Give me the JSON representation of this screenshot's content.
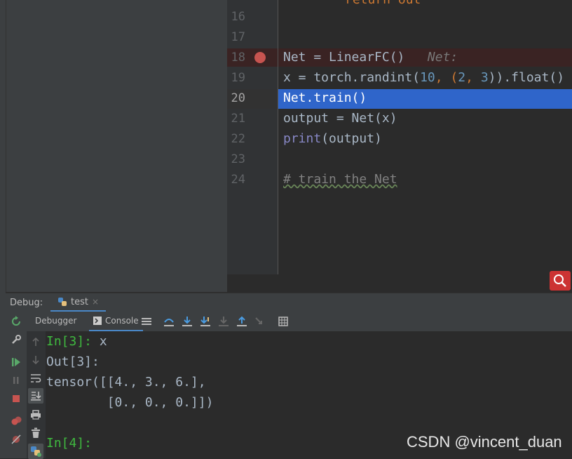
{
  "editor": {
    "line_numbers": [
      "16",
      "17",
      "18",
      "19",
      "20",
      "21",
      "22",
      "23",
      "24"
    ],
    "partial_top_line": "return out",
    "lines": {
      "l18_a": "Net = LinearFC()",
      "l18_hint": "Net:",
      "l19_a": "x = torch.randint(",
      "l19_n1": "10",
      "l19_b": ", (",
      "l19_n2": "2",
      "l19_c": ", ",
      "l19_n3": "3",
      "l19_d": ")).float()",
      "l20": "Net.train()",
      "l21": "output = Net(x)",
      "l22_fn": "print",
      "l22_rest": "(output)",
      "l24": "# train the Net"
    }
  },
  "debug": {
    "label": "Debug:",
    "run_tab": "test",
    "tabs": {
      "debugger": "Debugger",
      "console": "Console"
    }
  },
  "console": {
    "lines": {
      "in3_prompt": "In[3]:",
      "in3_code": " x",
      "out3": "Out[3]:",
      "t1": "tensor([[4., 3., 6.],",
      "t2": "        [0., 0., 0.]])",
      "in4_prompt": "In[4]:"
    }
  },
  "watermark": "CSDN @vincent_duan",
  "colors": {
    "accent": "#4a88c7",
    "breakpoint": "#c75450",
    "selection": "#2f65ca",
    "prompt": "#3fb93f"
  }
}
